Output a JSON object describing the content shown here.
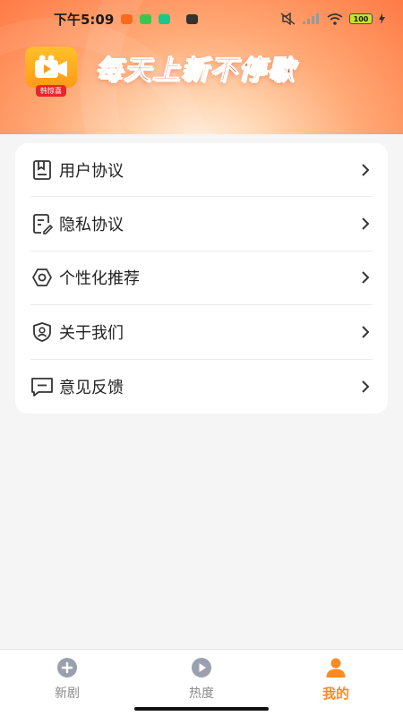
{
  "status_bar": {
    "time": "下午5:09",
    "battery": "100"
  },
  "brand": {
    "logo_label": "韩惊喜",
    "slogan": "每天上新不停歇"
  },
  "menu": {
    "items": [
      {
        "label": "用户协议",
        "icon": "document-icon"
      },
      {
        "label": "隐私协议",
        "icon": "edit-document-icon"
      },
      {
        "label": "个性化推荐",
        "icon": "gear-icon"
      },
      {
        "label": "关于我们",
        "icon": "shield-user-icon"
      },
      {
        "label": "意见反馈",
        "icon": "message-icon"
      }
    ]
  },
  "bottom_nav": {
    "items": [
      {
        "label": "新剧",
        "icon": "plus-circle-icon",
        "active": false
      },
      {
        "label": "热度",
        "icon": "play-circle-icon",
        "active": false
      },
      {
        "label": "我的",
        "icon": "user-icon",
        "active": true
      }
    ]
  },
  "colors": {
    "accent": "#ff8a20",
    "slogan": "#e3321f",
    "nav_inactive": "#8a8a8a"
  }
}
